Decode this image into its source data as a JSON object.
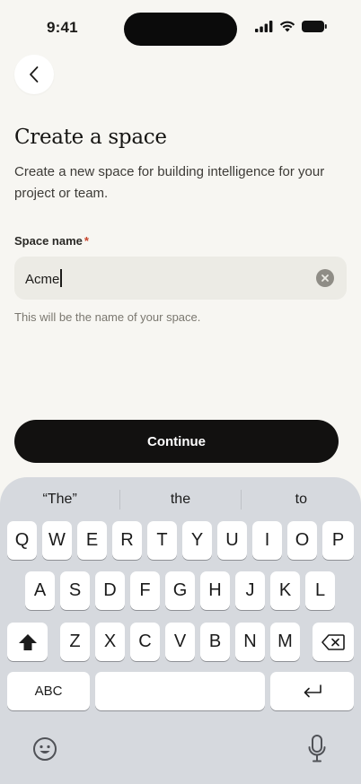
{
  "status": {
    "time": "9:41"
  },
  "page": {
    "title": "Create a space",
    "description": "Create a new space for building intelligence for your project or team."
  },
  "form": {
    "label": "Space name",
    "required_mark": "*",
    "value": "Acme",
    "helper": "This will be the name of your space."
  },
  "actions": {
    "continue_label": "Continue"
  },
  "keyboard": {
    "suggestions": [
      "“The”",
      "the",
      "to"
    ],
    "row1": [
      "Q",
      "W",
      "E",
      "R",
      "T",
      "Y",
      "U",
      "I",
      "O",
      "P"
    ],
    "row2": [
      "A",
      "S",
      "D",
      "F",
      "G",
      "H",
      "J",
      "K",
      "L"
    ],
    "row3": [
      "Z",
      "X",
      "C",
      "V",
      "B",
      "N",
      "M"
    ],
    "abc_label": "ABC"
  }
}
